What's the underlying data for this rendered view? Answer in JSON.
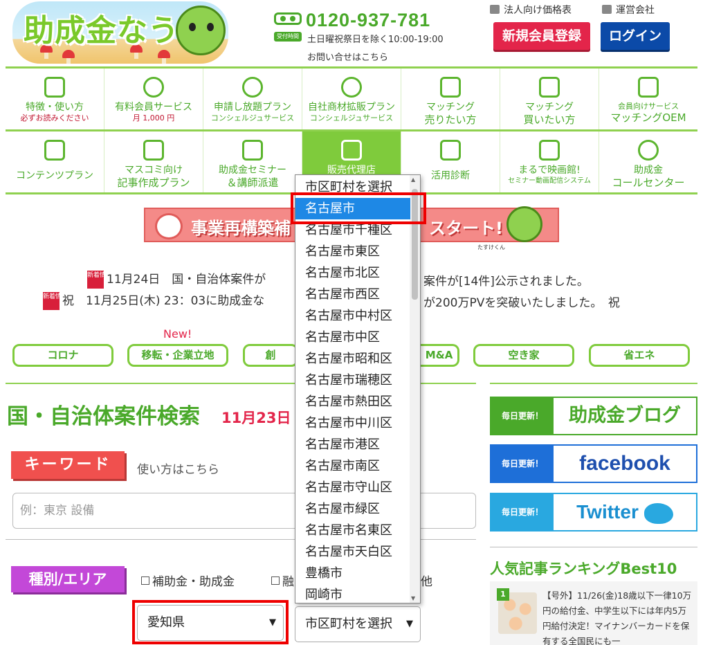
{
  "header": {
    "logo_text": "助成金なう",
    "uketsuke": "受付時間",
    "phone": "0120-937-781",
    "hours": "土日曜祝祭日を除く10:00-19:00",
    "contact": "お問い合せはこちら",
    "link_pricing": "法人向け価格表",
    "link_company": "運営会社",
    "register": "新規会員登録",
    "login": "ログイン"
  },
  "nav": {
    "row1": [
      {
        "l1": "特徴・使い方",
        "l2": "必ずお読みください"
      },
      {
        "l1": "有料会員サービス",
        "l2": "月 1,000 円"
      },
      {
        "l1": "申請し放題プラン",
        "l2": "コンシェルジュサービス"
      },
      {
        "l1": "自社商材拡販プラン",
        "l2": "コンシェルジュサービス"
      },
      {
        "l1": "マッチング",
        "l2": "売りたい方"
      },
      {
        "l1": "マッチング",
        "l2": "買いたい方"
      },
      {
        "l1": "会員向けサービス",
        "l2": "マッチングOEM"
      }
    ],
    "row2": [
      {
        "l1": "コンテンツプラン",
        "l2": ""
      },
      {
        "l1": "マスコミ向け",
        "l2": "記事作成プラン"
      },
      {
        "l1": "助成金セミナー",
        "l2": "＆講師派遣"
      },
      {
        "l1": "販売代理店",
        "l2": ""
      },
      {
        "l1": "活用診断",
        "l2": ""
      },
      {
        "l1": "まるで映画館!",
        "l2": "セミナー動画配信システム"
      },
      {
        "l1": "助成金",
        "l2": "コールセンター"
      }
    ]
  },
  "banner": {
    "text_left": "事業再構築補",
    "text_right": "スタート!",
    "caption": "たすけくん"
  },
  "news": {
    "badge": "新着情報",
    "item1": "11月24日　国・自治体案件が",
    "item1_tail": "案件が[14件]公示されました。",
    "item2": "祝　11月25日(木) 23：03に助成金な",
    "item2_tail": "が200万PVを突破いたしました。　祝"
  },
  "categories": {
    "new_label": "New!",
    "items": [
      "コロナ",
      "移転・企業立地",
      "創",
      "M&A",
      "空き家",
      "省エネ"
    ]
  },
  "search": {
    "title": "国・自治体案件検索",
    "date": "11月23日",
    "keyword_label": "キーワード",
    "howto": "使い方はこちら",
    "keyword_placeholder": "例：東京 設備",
    "area_label": "種別/エリア",
    "check1": "補助金・助成金",
    "check2": "融",
    "check3_tail": "他",
    "pref_value": "愛知県",
    "city_value": "市区町村を選択"
  },
  "dropdown": {
    "options": [
      "市区町村を選択",
      "名古屋市",
      "名古屋市千種区",
      "名古屋市東区",
      "名古屋市北区",
      "名古屋市西区",
      "名古屋市中村区",
      "名古屋市中区",
      "名古屋市昭和区",
      "名古屋市瑞穂区",
      "名古屋市熱田区",
      "名古屋市中川区",
      "名古屋市港区",
      "名古屋市南区",
      "名古屋市守山区",
      "名古屋市緑区",
      "名古屋市名東区",
      "名古屋市天白区",
      "豊橋市",
      "岡崎市"
    ],
    "selected_index": 1
  },
  "sidebar": {
    "daily": "毎日更新！",
    "blog": "助成金ブログ",
    "facebook": "facebook",
    "twitter": "Twitter",
    "ranking_title": "人気記事ランキングBest10",
    "rank1_num": "1",
    "rank1_text": "【号外】11/26(金)18歳以下一律10万円の給付金、中学生以下には年内5万円給付決定！マイナンバーカードを保有する全国民にも一"
  },
  "colors": {
    "brand_green": "#7fcb3c",
    "register_red": "#e3254a",
    "login_blue": "#0b4aa8",
    "highlight_red": "#e00000",
    "selected_blue": "#1e88e5"
  }
}
